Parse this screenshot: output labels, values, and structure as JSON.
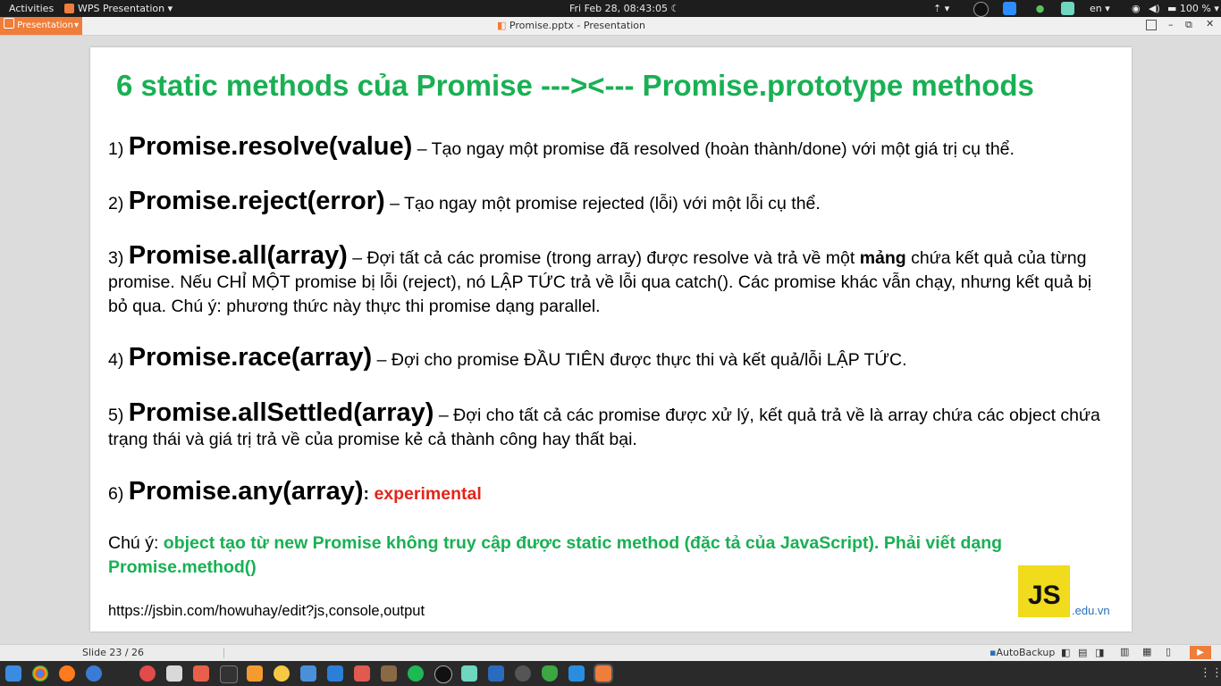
{
  "topbar": {
    "activities": "Activities",
    "app_menu": "WPS Presentation",
    "clock": "Fri Feb 28, 08:43:05",
    "language": "en",
    "battery": "100 %"
  },
  "window": {
    "app_tab": "Presentation",
    "title": "Promise.pptx - Presentation"
  },
  "slide": {
    "title": "6 static methods của Promise --->",
    "title_part2": "<--- Promise.prototype methods",
    "methods": [
      {
        "num": "1)",
        "name": "Promise.resolve(value)",
        "desc": "– Tạo ngay một promise đã resolved (hoàn thành/done) với một giá trị cụ thể."
      },
      {
        "num": "2)",
        "name": "Promise.reject(error)",
        "desc": "– Tạo ngay một promise rejected (lỗi) với một lỗi cụ thể."
      },
      {
        "num": "3)",
        "name": "Promise.all(array)",
        "desc_a": "– Đợi tất cả các promise (trong array) được resolve và trả về một",
        "desc_bold": "mảng",
        "desc_b": "chứa kết quả của từng promise. Nếu CHỈ MỘT promise bị lỗi (reject), nó LẬP TỨC trả về lỗi qua catch(). Các promise khác vẫn chạy, nhưng kết quả bị bỏ qua. Chú ý: phương thức này thực thi promise dạng parallel."
      },
      {
        "num": "4)",
        "name": "Promise.race(array)",
        "desc": "– Đợi cho promise ĐẦU TIÊN được thực thi và kết quả/lỗi LẬP TỨC."
      },
      {
        "num": "5)",
        "name": "Promise.allSettled(array)",
        "desc": "– Đợi cho tất cả các promise được xử lý, kết quả trả về là array chứa các object chứa trạng thái và giá trị trả về của promise kẻ cả thành công hay thất bại."
      },
      {
        "num": "6)",
        "name": "Promise.any(array)",
        "colon": ":",
        "tag": "experimental"
      }
    ],
    "note_label": "Chú ý:",
    "note_text": "object tạo từ new Promise không truy cập được static method (đặc tả của JavaScript). Phải viết dạng Promise.method()",
    "url": "https://jsbin.com/howuhay/edit?js,console,output",
    "logo_text": "JS",
    "logo_domain": ".edu.vn"
  },
  "status": {
    "slide_counter": "Slide 23 / 26",
    "autobackup": "AutoBackup"
  },
  "colors": {
    "title_green": "#19b054",
    "experimental_red": "#e1251b",
    "wps_orange": "#ef7d3b",
    "js_yellow": "#f0db1c"
  },
  "taskbar_icons": [
    "show-apps-icon",
    "chrome-icon",
    "firefox-icon",
    "thunderbird-icon",
    "music-icon",
    "archive-icon",
    "screenshot-icon",
    "terminal-icon",
    "sublime-icon",
    "clock-icon",
    "files-icon",
    "writer-icon",
    "pdf-icon",
    "package-icon",
    "spotify-icon",
    "obs-icon",
    "gallery-icon",
    "calendar-icon",
    "inkscape-icon",
    "shield-icon",
    "vscode-icon",
    "wps-presentation-icon"
  ]
}
